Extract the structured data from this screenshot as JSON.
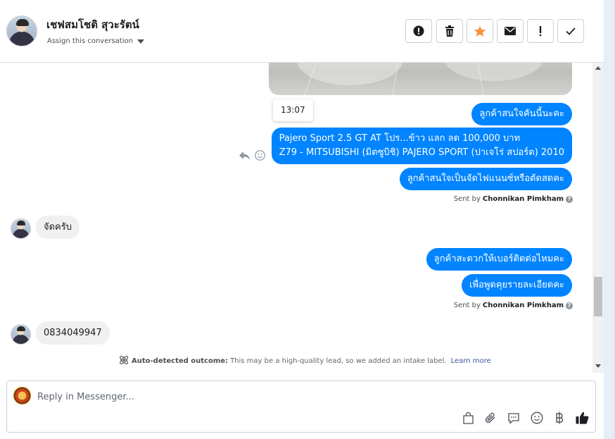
{
  "header": {
    "contact_name": "เชฟสมโชติ สุวะรัตน์",
    "assign_label": "Assign this conversation",
    "actions": [
      {
        "name": "spam",
        "icon": "alert-circle-icon"
      },
      {
        "name": "delete",
        "icon": "trash-icon"
      },
      {
        "name": "star",
        "icon": "star-icon"
      },
      {
        "name": "mark-unread",
        "icon": "envelope-icon"
      },
      {
        "name": "follow-up",
        "icon": "exclamation-icon"
      },
      {
        "name": "mark-done",
        "icon": "check-icon"
      }
    ]
  },
  "conversation": {
    "tooltip_time": "13:07",
    "messages_out_1": [
      "ลูกค้าสนใจคันนี้นะคะ",
      "Pajero Sport 2.5 GT AT โปร...ข้าว แลก ลด 100,000 บาท",
      "Z79 - MITSUBISHI (มิตซูบิชิ) PAJERO SPORT (ปาเจโร่ สปอร์ต) 2010",
      "ลูกค้าสนใจเป็นจัดไฟแนนซ์หรือตัดสดคะ"
    ],
    "sent_by_prefix": "Sent by",
    "sent_by_name": "Chonnikan Pimkham",
    "help_mark": "?",
    "message_in_1": "จัดครับ",
    "messages_out_2": [
      "ลูกค้าสะดวกให้เบอร์ติดต่อไหมคะ",
      "เพื่อพูดคุยรายละเอียดคะ"
    ],
    "message_in_2": "0834049947",
    "outcome": {
      "label": "Auto-detected outcome:",
      "text": "This may be a high-quality lead, so we added an intake label.",
      "link": "Learn more"
    }
  },
  "composer": {
    "placeholder": "Reply in Messenger...",
    "tools": [
      "shopping-bag-icon",
      "paperclip-icon",
      "saved-reply-icon",
      "emoji-icon",
      "baht-icon",
      "thumbs-up-icon"
    ]
  },
  "colors": {
    "outgoing_bubble": "#0084ff",
    "incoming_bubble": "#f1f0f0",
    "star": "#f7923b"
  }
}
